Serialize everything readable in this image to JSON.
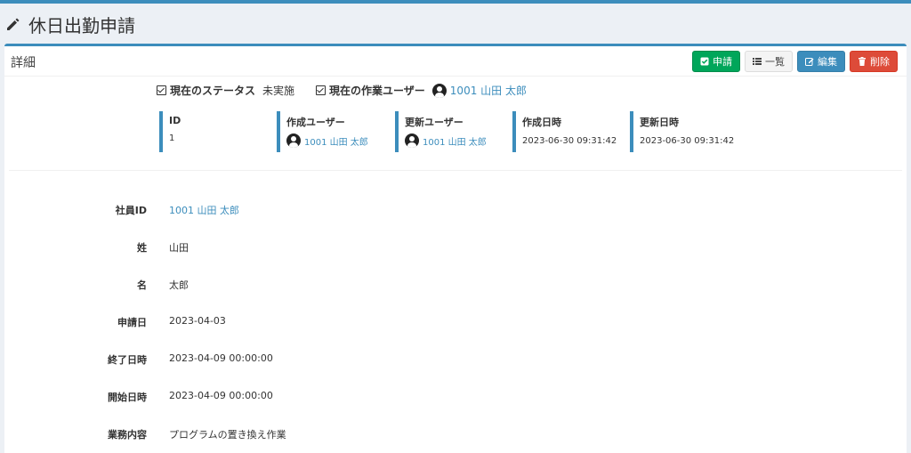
{
  "page": {
    "title": "休日出勤申請"
  },
  "box": {
    "title": "詳細"
  },
  "toolbar": {
    "apply_label": "申請",
    "list_label": "一覧",
    "edit_label": "編集",
    "delete_label": "削除"
  },
  "status": {
    "status_label": "現在のステータス",
    "status_value": "未実施",
    "worker_label": "現在の作業ユーザー",
    "worker_value": "1001 山田 太郎"
  },
  "meta": {
    "id_label": "ID",
    "id_value": "1",
    "created_by_label": "作成ユーザー",
    "created_by_value": "1001 山田 太郎",
    "updated_by_label": "更新ユーザー",
    "updated_by_value": "1001 山田 太郎",
    "created_at_label": "作成日時",
    "created_at_value": "2023-06-30 09:31:42",
    "updated_at_label": "更新日時",
    "updated_at_value": "2023-06-30 09:31:42"
  },
  "fields": [
    {
      "label": "社員ID",
      "value": "1001 山田 太郎"
    },
    {
      "label": "姓",
      "value": "山田"
    },
    {
      "label": "名",
      "value": "太郎"
    },
    {
      "label": "申請日",
      "value": "2023-04-03"
    },
    {
      "label": "終了日時",
      "value": "2023-04-09 00:00:00"
    },
    {
      "label": "開始日時",
      "value": "2023-04-09 00:00:00"
    },
    {
      "label": "業務内容",
      "value": "プログラムの置き換え作業"
    }
  ],
  "colors": {
    "accent": "#3c8dbc",
    "success": "#00a65a",
    "danger": "#dd4b39",
    "background": "#ecf0f5"
  }
}
